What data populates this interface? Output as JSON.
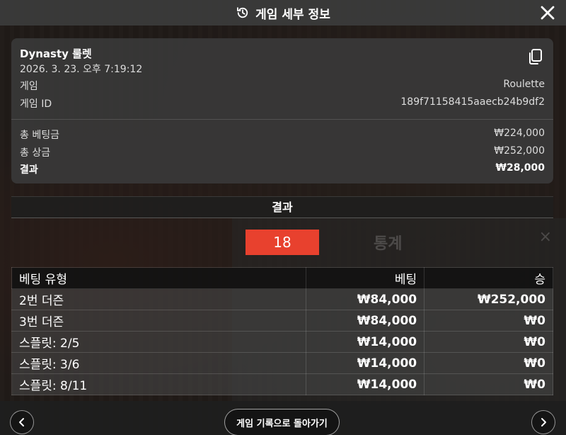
{
  "header": {
    "title": "게임 세부 정보",
    "icon": "history-icon",
    "close_icon": "close-icon"
  },
  "summary": {
    "game_name": "Dynasty 룰렛",
    "datetime": "2026. 3. 23. 오후 7:19:12",
    "game_label": "게임",
    "game_value": "Roulette",
    "game_id_label": "게임 ID",
    "game_id_value": "189f71158415aaecb24b9df2",
    "total_bet_label": "총 베팅금",
    "total_bet_value": "₩224,000",
    "total_prize_label": "총 상금",
    "total_prize_value": "₩252,000",
    "result_label": "결과",
    "result_value": "₩28,000",
    "copy_icon": "copy-icon"
  },
  "result": {
    "header": "결과",
    "number": "18",
    "number_color": "#e8412e"
  },
  "bets": {
    "columns": [
      "베팅 유형",
      "베팅",
      "승"
    ],
    "rows": [
      {
        "type": "2번 더즌",
        "bet": "₩84,000",
        "win": "₩252,000"
      },
      {
        "type": "3번 더즌",
        "bet": "₩84,000",
        "win": "₩0"
      },
      {
        "type": "스플릿: 2/5",
        "bet": "₩14,000",
        "win": "₩0"
      },
      {
        "type": "스플릿: 3/6",
        "bet": "₩14,000",
        "win": "₩0"
      },
      {
        "type": "스플릿: 8/11",
        "bet": "₩14,000",
        "win": "₩0"
      }
    ]
  },
  "footer": {
    "back_label": "게임 기록으로 돌아가기",
    "prev_icon": "chevron-left-icon",
    "next_icon": "chevron-right-icon"
  },
  "stats_overlay": {
    "title": "통계",
    "close": "×"
  }
}
